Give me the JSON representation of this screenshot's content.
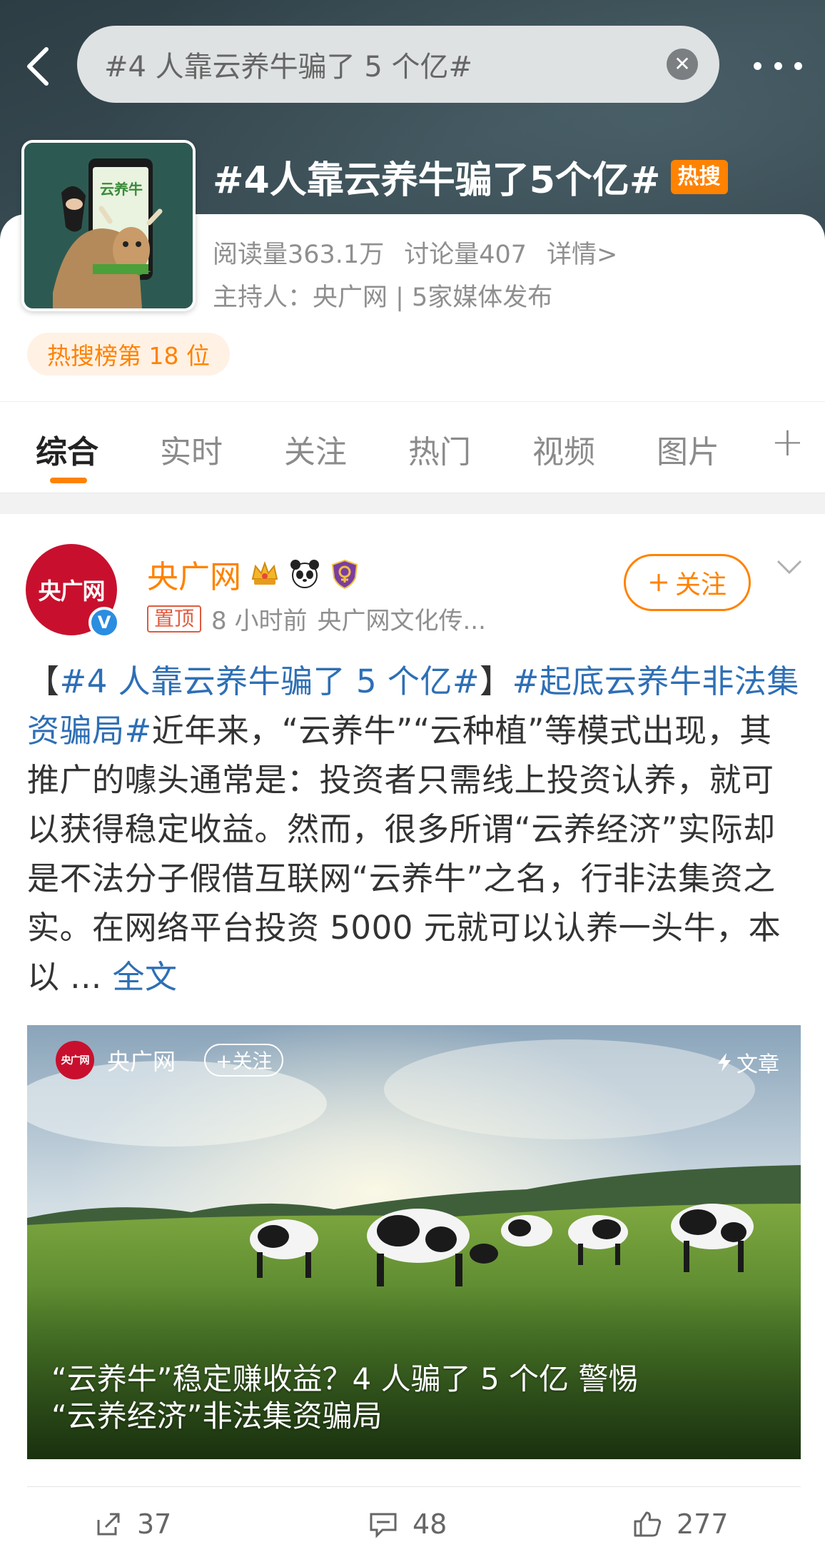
{
  "search": {
    "query": "#4 人靠云养牛骗了 5 个亿#"
  },
  "topic": {
    "title": "#4人靠云养牛骗了5个亿#",
    "hot_badge": "热搜",
    "cover_text": "云养牛",
    "reads": "阅读量363.1万",
    "discussions": "讨论量407",
    "details": "详情>",
    "host": "主持人：央广网 | 5家媒体发布",
    "rank": "热搜榜第 18 位"
  },
  "tabs": [
    {
      "label": "综合",
      "active": true
    },
    {
      "label": "实时"
    },
    {
      "label": "关注"
    },
    {
      "label": "热门"
    },
    {
      "label": "视频"
    },
    {
      "label": "图片"
    }
  ],
  "post": {
    "author": "央广网",
    "avatar_text": "央广网",
    "pinned": "置顶",
    "time": "8 小时前",
    "source": "央广网文化传...",
    "follow": "关注",
    "body": {
      "bracket_open": "【",
      "topic1": "#4 人靠云养牛骗了 5 个亿#",
      "bracket_close": "】",
      "topic2": "#起底云养牛非法集资骗局#",
      "text": "近年来，“云养牛”“云种植”等模式出现，其推广的噱头通常是：投资者只需线上投资认养，就可以获得稳定收益。然而，很多所谓“云养经济”实际却是不法分子假借互联网“云养牛”之名，行非法集资之实。在网络平台投资 5000 元就可以认养一头牛，本以 ... ",
      "more": "全文"
    },
    "card": {
      "source": "央广网",
      "avatar_text": "央广网",
      "follow": "+关注",
      "type": "文章",
      "title_line1": "“云养牛”稳定赚收益？4 人骗了 5 个亿 警惕",
      "title_line2": "“云养经济”非法集资骗局"
    },
    "actions": {
      "reposts": "37",
      "comments": "48",
      "likes": "277"
    }
  },
  "colors": {
    "accent": "#ff8200",
    "link": "#2e6fb5",
    "brand_red": "#c8102e"
  }
}
